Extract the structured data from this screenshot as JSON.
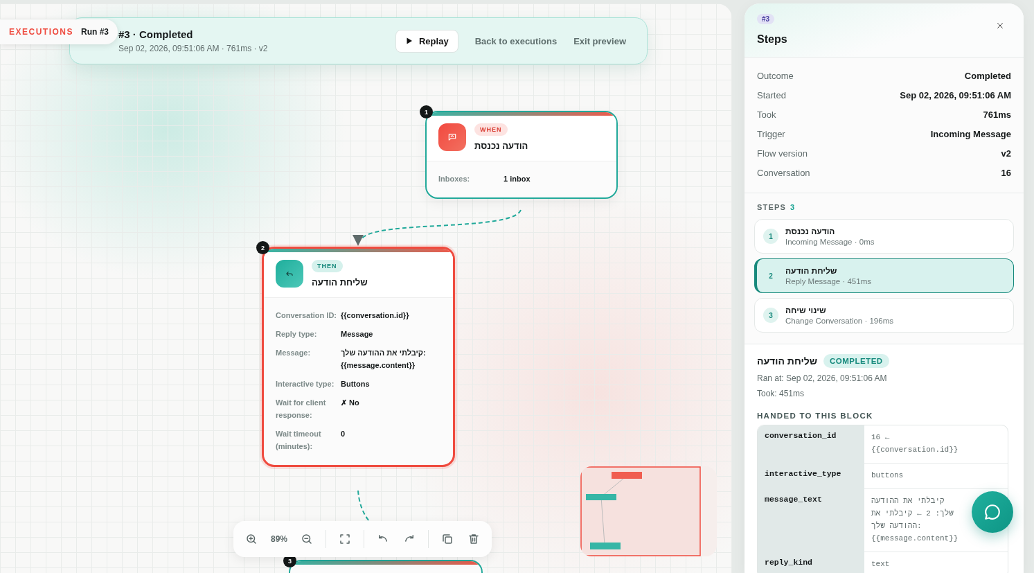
{
  "breadcrumb": {
    "section": "EXECUTIONS",
    "run": "Run #3"
  },
  "header": {
    "title": "#3 · Completed",
    "subtitle": "Sep 02, 2026, 09:51:06 AM · 761ms · v2",
    "buttons": [
      {
        "label": "Replay",
        "kind": "primary"
      },
      {
        "label": "Back to executions",
        "kind": "link"
      },
      {
        "label": "Exit preview",
        "kind": "link"
      }
    ]
  },
  "nodes": [
    {
      "number": "1",
      "kind": "trigger",
      "tag": "WHEN",
      "title": "הודעה נכנסת",
      "selected": false,
      "fields": [
        {
          "label": "Inboxes:",
          "value": "1 inbox"
        }
      ]
    },
    {
      "number": "2",
      "kind": "action",
      "tag": "THEN",
      "title": "שליחת הודעה",
      "selected": true,
      "fields": [
        {
          "label": "Conversation ID:",
          "value": "{{conversation.id}}"
        },
        {
          "label": "Reply type:",
          "value": "Message"
        },
        {
          "label": "Message:",
          "value": "קיבלתי את ההודעה שלך: {{message.content}}"
        },
        {
          "label": "Interactive type:",
          "value": "Buttons"
        },
        {
          "label": "Wait for client response:",
          "value": "✗ No"
        },
        {
          "label": "Wait timeout (minutes):",
          "value": "0"
        }
      ]
    },
    {
      "number": "3",
      "kind": "action",
      "selected": false
    }
  ],
  "toolbar": {
    "zoom": "89%"
  },
  "panel": {
    "badge": "#3",
    "title": "Steps",
    "summary": [
      {
        "label": "Outcome",
        "value": "Completed"
      },
      {
        "label": "Started",
        "value": "Sep 02, 2026, 09:51:06 AM"
      },
      {
        "label": "Took",
        "value": "761ms"
      },
      {
        "label": "Trigger",
        "value": "Incoming Message"
      },
      {
        "label": "Flow version",
        "value": "v2"
      },
      {
        "label": "Conversation",
        "value": "16"
      }
    ],
    "steps_heading": "STEPS",
    "steps_count": "3",
    "steps": [
      {
        "number": "1",
        "title": "הודעה נכנסת",
        "subtitle": "Incoming Message · 0ms",
        "selected": false
      },
      {
        "number": "2",
        "title": "שליחת הודעה",
        "subtitle": "Reply Message · 451ms",
        "selected": true
      },
      {
        "number": "3",
        "title": "שינוי שיחה",
        "subtitle": "Change Conversation · 196ms",
        "selected": false
      }
    ],
    "detail": {
      "title": "שליחת הודעה",
      "status": "COMPLETED",
      "ran_at": "Ran at: Sep 02, 2026, 09:51:06 AM",
      "took": "Took: 451ms",
      "inputs_heading": "HANDED TO THIS BLOCK",
      "inputs": [
        {
          "key": "conversation_id",
          "value": "16 ← {{conversation.id}}"
        },
        {
          "key": "interactive_type",
          "value": "buttons"
        },
        {
          "key": "message_text",
          "value": "קיבלתי את ההודעה שלך: 2 ← קיבלתי את ההודעה שלך: {{message.content}}"
        },
        {
          "key": "reply_kind",
          "value": "text"
        }
      ]
    }
  }
}
